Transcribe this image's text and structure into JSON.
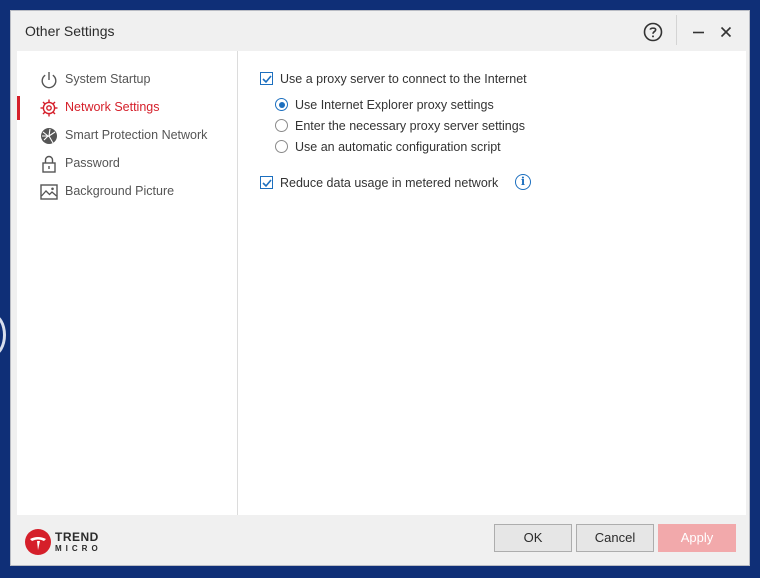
{
  "window": {
    "title": "Other Settings"
  },
  "sidebar": {
    "items": [
      {
        "label": "System Startup",
        "icon": "power-icon",
        "active": false
      },
      {
        "label": "Network Settings",
        "icon": "gear-icon",
        "active": true
      },
      {
        "label": "Smart Protection Network",
        "icon": "globe-icon",
        "active": false
      },
      {
        "label": "Password",
        "icon": "lock-icon",
        "active": false
      },
      {
        "label": "Background Picture",
        "icon": "picture-icon",
        "active": false
      }
    ]
  },
  "network": {
    "use_proxy": {
      "label": "Use a proxy server to connect to the Internet",
      "checked": true
    },
    "proxy_options": [
      {
        "label": "Use Internet Explorer proxy settings",
        "selected": true
      },
      {
        "label": "Enter the necessary proxy server settings",
        "selected": false
      },
      {
        "label": "Use an automatic configuration script",
        "selected": false
      }
    ],
    "reduce_data": {
      "label": "Reduce data usage in metered network",
      "checked": true,
      "info_icon": "info-icon"
    }
  },
  "footer": {
    "logo_line1": "TREND",
    "logo_line2": "MICRO",
    "ok_label": "OK",
    "cancel_label": "Cancel",
    "apply_label": "Apply"
  },
  "colors": {
    "accent": "#d51f2a",
    "link": "#1c6fbf",
    "apply_disabled": "#f2a9ab",
    "desktop": "#0f2f77"
  }
}
